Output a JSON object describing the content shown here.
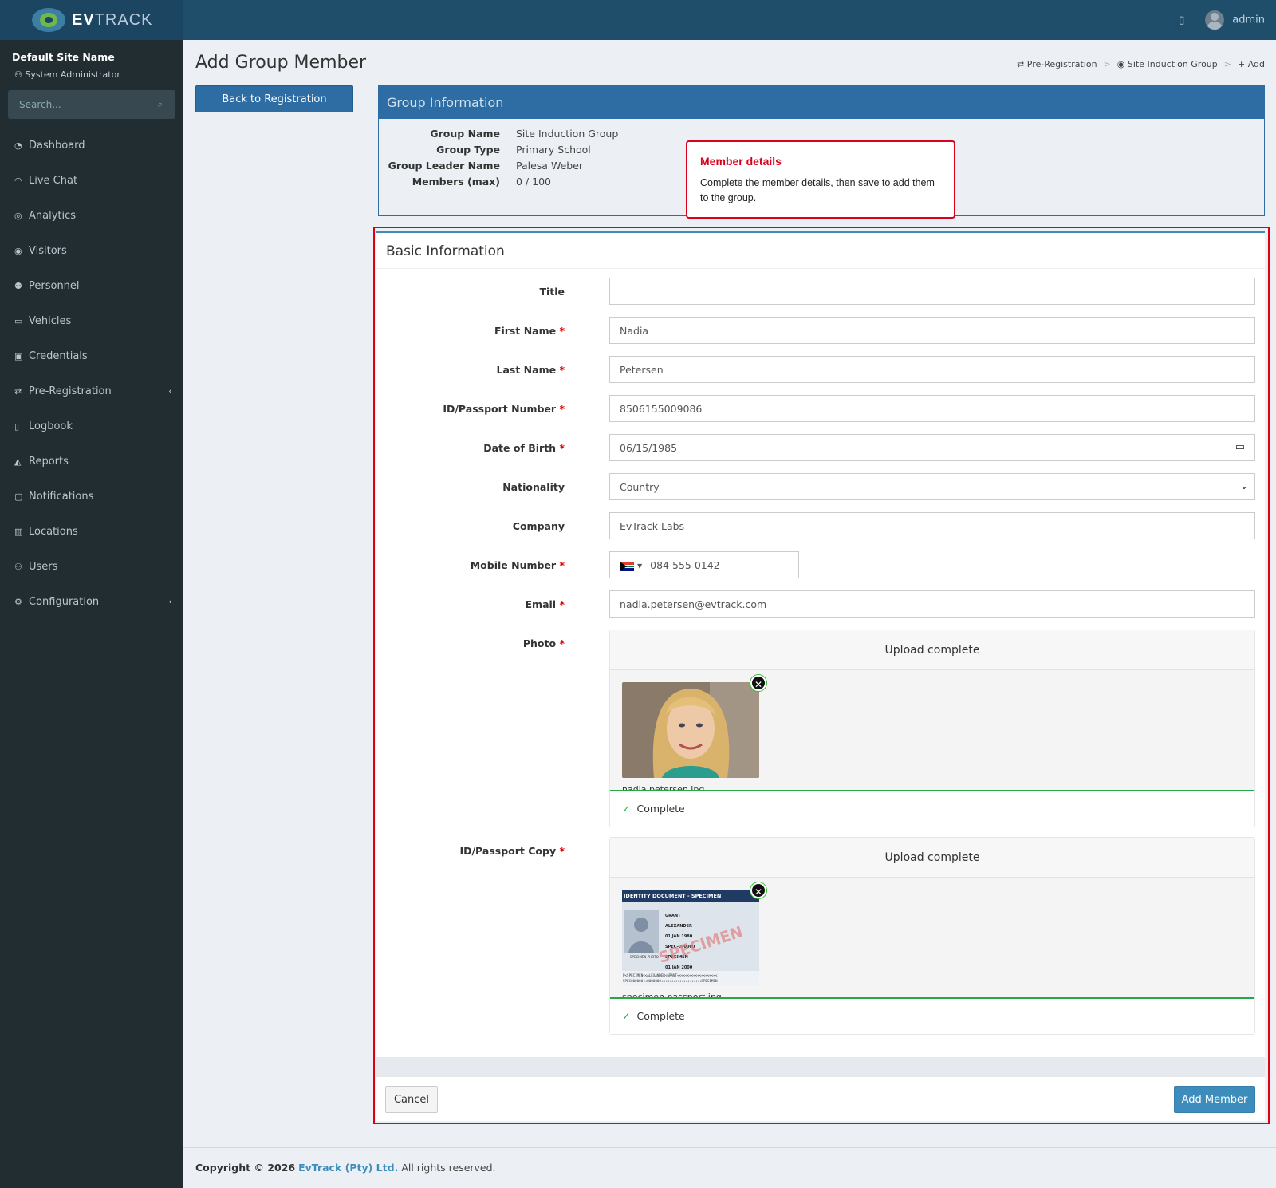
{
  "app": {
    "logo_text_bold": "EV",
    "logo_text_rest": "TRACK",
    "user": "admin"
  },
  "sidebar": {
    "site_name": "Default Site Name",
    "role": "System Administrator",
    "search_placeholder": "Search...",
    "items": [
      {
        "label": "Dashboard",
        "icon": "dashboard-icon"
      },
      {
        "label": "Live Chat",
        "icon": "headset-icon"
      },
      {
        "label": "Analytics",
        "icon": "target-icon"
      },
      {
        "label": "Visitors",
        "icon": "eye-icon"
      },
      {
        "label": "Personnel",
        "icon": "personnel-icon"
      },
      {
        "label": "Vehicles",
        "icon": "car-icon"
      },
      {
        "label": "Credentials",
        "icon": "badge-icon"
      },
      {
        "label": "Pre-Registration",
        "icon": "exchange-icon",
        "has_children": true
      },
      {
        "label": "Logbook",
        "icon": "book-icon"
      },
      {
        "label": "Reports",
        "icon": "chart-icon"
      },
      {
        "label": "Notifications",
        "icon": "chat-icon"
      },
      {
        "label": "Locations",
        "icon": "map-icon"
      },
      {
        "label": "Users",
        "icon": "users-icon"
      },
      {
        "label": "Configuration",
        "icon": "gear-icon",
        "has_children": true
      }
    ]
  },
  "page": {
    "title": "Add Group Member",
    "breadcrumb": [
      "Pre-Registration",
      "Site Induction Group",
      "Add"
    ],
    "back_button": "Back to Registration"
  },
  "group": {
    "header": "Group Information",
    "rows": [
      {
        "label": "Group Name",
        "value": "Site Induction Group"
      },
      {
        "label": "Group Type",
        "value": "Primary School"
      },
      {
        "label": "Group Leader Name",
        "value": "Palesa Weber"
      },
      {
        "label": "Members (max)",
        "value": "0 / 100"
      }
    ]
  },
  "tooltip": {
    "title": "Member details",
    "body": "Complete the member details, then save to add them to the group."
  },
  "form": {
    "title": "Basic Information",
    "fields": {
      "title": {
        "label": "Title",
        "value": ""
      },
      "first_name": {
        "label": "First Name",
        "value": "Nadia"
      },
      "last_name": {
        "label": "Last Name",
        "value": "Petersen"
      },
      "id_number": {
        "label": "ID/Passport Number",
        "value": "8506155009086"
      },
      "dob": {
        "label": "Date of Birth",
        "value": "06/15/1985"
      },
      "nationality": {
        "label": "Nationality",
        "value": "Country"
      },
      "company": {
        "label": "Company",
        "value": "EvTrack Labs"
      },
      "mobile": {
        "label": "Mobile Number",
        "value": "084 555 0142"
      },
      "email": {
        "label": "Email",
        "value": "nadia.petersen@evtrack.com"
      }
    },
    "req": "*",
    "photo": {
      "label": "Photo",
      "status_head": "Upload complete",
      "file": "nadia.petersen.jpg",
      "status": "Complete"
    },
    "id_copy": {
      "label": "ID/Passport Copy",
      "status_head": "Upload complete",
      "file": "specimen.passport.jpg",
      "status": "Complete",
      "doc_header": "IDENTITY DOCUMENT - SPECIMEN",
      "doc_surname": "GRANT",
      "doc_names": "ALEXANDER",
      "doc_dob": "01 JAN 1980",
      "doc_number": "SPEC-000000",
      "doc_nationality": "SPECIMEN",
      "doc_issued": "01 JAN 2000",
      "doc_photo_caption": "SPECIMEN PHOTO",
      "doc_watermark": "SPECIMEN",
      "doc_mrz1": "P<SPECIMEN<<ALEXANDER<GRANT<<<<<<<<<<<<<<<<<<<<",
      "doc_mrz2": "SPEC000000<<0000000<<<<<<<<<<<<<<<<<<<<SPECIMEN"
    },
    "cancel": "Cancel",
    "submit": "Add Member"
  },
  "footer": {
    "prefix": "Copyright © 2026",
    "company": "EvTrack (Pty) Ltd.",
    "suffix": "All rights reserved."
  },
  "colors": {
    "brand": "#1f4e6b",
    "primary": "#3c8dbc",
    "highlight": "#e00010",
    "success": "#28a745"
  }
}
